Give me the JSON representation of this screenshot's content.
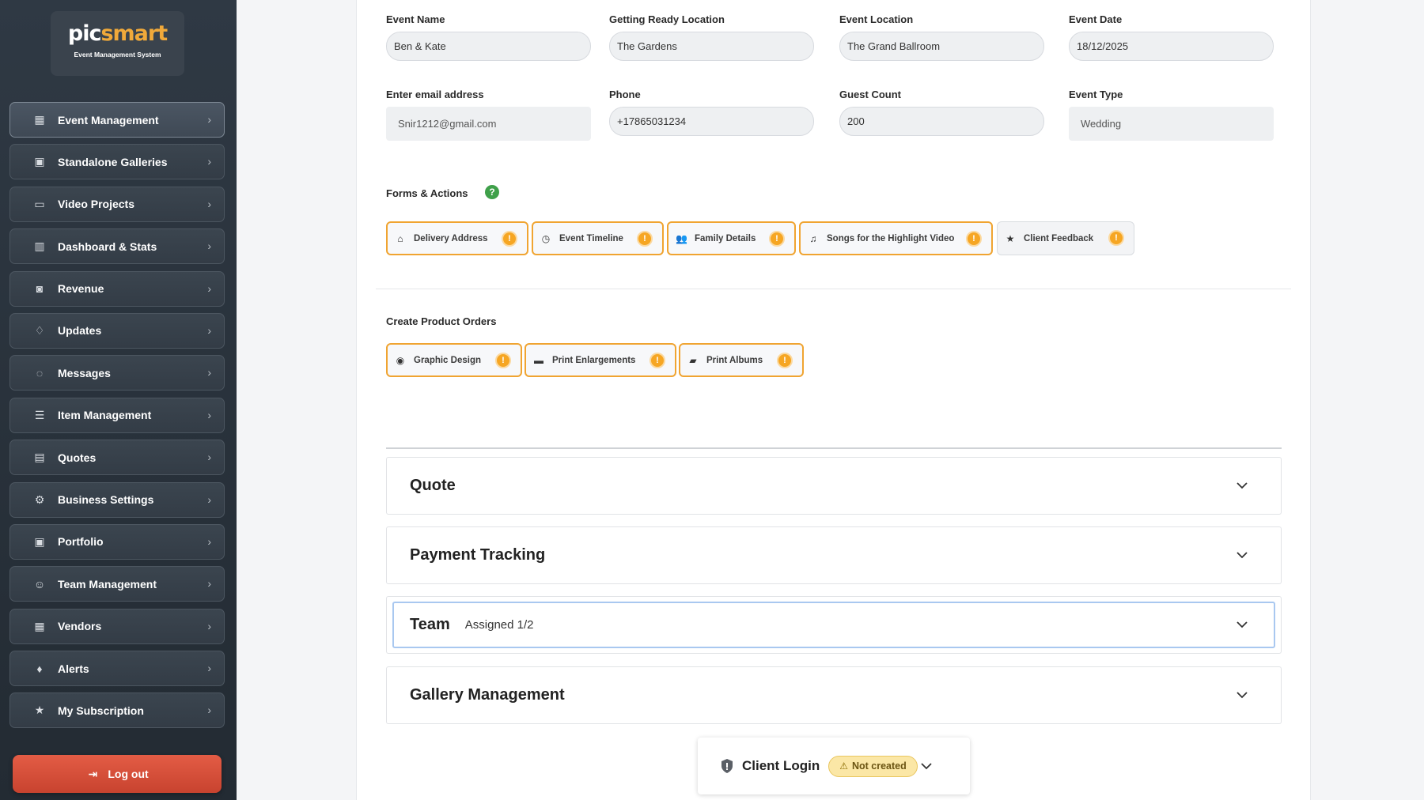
{
  "brand": {
    "name_a": "pic",
    "name_b": "smart",
    "tagline": "Event Management System"
  },
  "nav": {
    "items": [
      {
        "label": "Event Management",
        "icon": "calendar-icon",
        "glyph": "▦",
        "active": true
      },
      {
        "label": "Standalone Galleries",
        "icon": "gallery-icon",
        "glyph": "▣"
      },
      {
        "label": "Video Projects",
        "icon": "video-icon",
        "glyph": "▭"
      },
      {
        "label": "Dashboard & Stats",
        "icon": "bar-chart-icon",
        "glyph": "▥"
      },
      {
        "label": "Revenue",
        "icon": "money-icon",
        "glyph": "◙"
      },
      {
        "label": "Updates",
        "icon": "bell-outline-icon",
        "glyph": "♢"
      },
      {
        "label": "Messages",
        "icon": "chat-bubble-icon",
        "glyph": "◌"
      },
      {
        "label": "Item Management",
        "icon": "list-icon",
        "glyph": "☰"
      },
      {
        "label": "Quotes",
        "icon": "quote-doc-icon",
        "glyph": "▤"
      },
      {
        "label": "Business Settings",
        "icon": "gear-icon",
        "glyph": "⚙"
      },
      {
        "label": "Portfolio",
        "icon": "portfolio-icon",
        "glyph": "▣"
      },
      {
        "label": "Team Management",
        "icon": "team-icon",
        "glyph": "☺"
      },
      {
        "label": "Vendors",
        "icon": "building-icon",
        "glyph": "▦"
      },
      {
        "label": "Alerts",
        "icon": "bell-icon",
        "glyph": "♦"
      },
      {
        "label": "My Subscription",
        "icon": "star-icon",
        "glyph": "★"
      }
    ],
    "logout_label": "Log out"
  },
  "form": {
    "event_name": {
      "label": "Event Name",
      "value": "Ben & Kate"
    },
    "getting_ready": {
      "label": "Getting Ready Location",
      "value": "The Gardens"
    },
    "event_location": {
      "label": "Event Location",
      "value": "The Grand Ballroom"
    },
    "event_date": {
      "label": "Event Date",
      "value": "18/12/2025"
    },
    "email": {
      "label": "Enter email address",
      "value": "Snir1212@gmail.com"
    },
    "phone": {
      "label": "Phone",
      "value": "+17865031234"
    },
    "guest_count": {
      "label": "Guest Count",
      "value": "200"
    },
    "event_type": {
      "label": "Event Type",
      "value": "Wedding"
    }
  },
  "forms_actions": {
    "title": "Forms & Actions",
    "help": "?",
    "chips": [
      {
        "label": "Delivery Address",
        "glyph": "⌂"
      },
      {
        "label": "Event Timeline",
        "glyph": "◷"
      },
      {
        "label": "Family Details",
        "glyph": "👥"
      },
      {
        "label": "Songs for the Highlight Video",
        "glyph": "♫"
      },
      {
        "label": "Client Feedback",
        "glyph": "★"
      }
    ]
  },
  "product_orders": {
    "title": "Create Product Orders",
    "chips": [
      {
        "label": "Graphic Design",
        "glyph": "◉"
      },
      {
        "label": "Print Enlargements",
        "glyph": "▬"
      },
      {
        "label": "Print Albums",
        "glyph": "▰"
      }
    ]
  },
  "panels": {
    "quote": {
      "title": "Quote"
    },
    "payment": {
      "title": "Payment Tracking"
    },
    "team": {
      "title": "Team",
      "subtitle": "Assigned 1/2"
    },
    "gallery": {
      "title": "Gallery Management"
    }
  },
  "client_login": {
    "title": "Client Login",
    "status": "Not created"
  },
  "colors": {
    "accent": "#f0a431",
    "sidebar": "#2f3944",
    "logout": "#d94f3a",
    "help": "#3fa04a"
  }
}
